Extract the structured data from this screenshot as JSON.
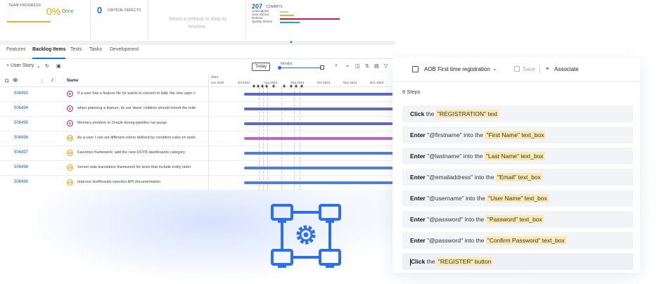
{
  "summary": {
    "team_progress": {
      "label": "TEAM PROGRESS",
      "value": "0%",
      "suffix": "Done"
    },
    "critical_defects": {
      "value": "0",
      "label": "CRITICAL DEFECTS"
    },
    "release_prompt": "Select a release to view its timeline.",
    "commits": {
      "value": "207",
      "label": "COMMITS",
      "rows": [
        {
          "label": "Unassigned",
          "color": "#c8c8c8"
        },
        {
          "label": "User Stories",
          "color": "#f2b01e"
        },
        {
          "label": "Defects",
          "color": "#c2185b"
        },
        {
          "label": "Quality Stories",
          "color": "#26a69a"
        }
      ]
    }
  },
  "tabs": [
    {
      "label": "Features"
    },
    {
      "label": "Backlog Items"
    },
    {
      "label": "Tests"
    },
    {
      "label": "Tasks"
    },
    {
      "label": "Development"
    }
  ],
  "toolbar": {
    "new_item": "+ User Story",
    "today": "Today",
    "zoom_label": "Months"
  },
  "grid": {
    "col_id": "ID",
    "col_name": "Name",
    "year": "2024",
    "months": [
      "Jun 2024",
      "Jul 2024",
      "Aug 2024",
      "Sep 2024",
      "Oct 2024",
      "Nov 2024",
      "Dec 2024"
    ],
    "rows": [
      {
        "id": "506493",
        "type": "D",
        "name": "If a user has a feature file he wants to convert to bdd, the new spec c",
        "bar_color": "#5c6bc0"
      },
      {
        "id": "506494",
        "type": "D",
        "name": "when planning a feature, its not 'done' children should inherit the mile",
        "bar_color": "#5c6bc0"
      },
      {
        "id": "506495",
        "type": "D",
        "name": "Memory problem in Oracle during pipeline run purge",
        "bar_color": "#5c6bc0"
      },
      {
        "id": "506496",
        "type": "US",
        "name": "As a user I can set different colors defined by condition rules on work",
        "bar_color": "#ba68c8"
      },
      {
        "id": "506497",
        "type": "US",
        "name": "Favorites framework: add the new OOTB dashboards category",
        "bar_color": "#4f7fd6"
      },
      {
        "id": "506498",
        "type": "US",
        "name": "Server-side translation framework for texts that include entity label",
        "bar_color": "#4f7fd6"
      },
      {
        "id": "506499",
        "type": "US",
        "name": "Improve testResults injection API documentation",
        "bar_color": "#4f7fd6"
      }
    ]
  },
  "test_panel": {
    "title": "AOB First time registration",
    "save": "Save",
    "associate": "Associate",
    "steps_count": "8 Steps",
    "steps": [
      {
        "verb": "Click",
        "mid1": "the",
        "value": "",
        "mid2": "",
        "target": "\"REGISTRATION\"",
        "kind": "text"
      },
      {
        "verb": "Enter",
        "mid1": "",
        "value": "\"@firstname\"",
        "mid2": "into the",
        "target": "\"First Name\"",
        "kind": "text_box"
      },
      {
        "verb": "Enter",
        "mid1": "",
        "value": "\"@lastname\"",
        "mid2": "into the",
        "target": "\"Last Name\"",
        "kind": "text_box"
      },
      {
        "verb": "Enter",
        "mid1": "",
        "value": "\"@emailaddress\"",
        "mid2": "into the",
        "target": "\"Email\"",
        "kind": "text_box"
      },
      {
        "verb": "Enter",
        "mid1": "",
        "value": "\"@username\"",
        "mid2": "into the",
        "target": "\"User Name\"",
        "kind": "text_box"
      },
      {
        "verb": "Enter",
        "mid1": "",
        "value": "\"@password\"",
        "mid2": "into the",
        "target": "\"Password\"",
        "kind": "text_box"
      },
      {
        "verb": "Enter",
        "mid1": "",
        "value": "\"@password\"",
        "mid2": "into the",
        "target": "\"Confirm Password\"",
        "kind": "text_box"
      },
      {
        "verb": "Click",
        "mid1": "the",
        "value": "",
        "mid2": "",
        "target": "\"REGISTER\"",
        "kind": "button"
      }
    ]
  },
  "colors": {
    "accent": "#1a73e8",
    "icon_blue": "#2f6fe8",
    "highlight": "#fbe9b3"
  }
}
